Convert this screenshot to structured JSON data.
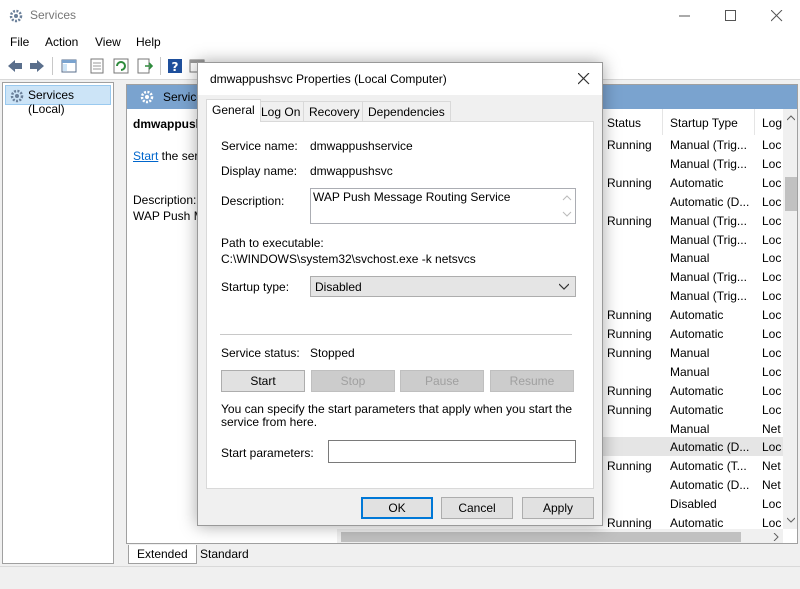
{
  "window": {
    "title": "Services",
    "menu": [
      "File",
      "Action",
      "View",
      "Help"
    ]
  },
  "tree": {
    "selected_label": "Services (Local)"
  },
  "banner": {
    "label": "Service"
  },
  "selected_service": {
    "name": "dmwappush",
    "start_link": "Start",
    "start_suffix": " the serv",
    "description_label": "Description:",
    "description_text": "WAP Push M"
  },
  "columns": {
    "status": "Status",
    "startup_type": "Startup Type",
    "log_on": "Log"
  },
  "rows": [
    {
      "status": "Running",
      "startup": "Manual (Trig...",
      "log": "Loc"
    },
    {
      "status": "",
      "startup": "Manual (Trig...",
      "log": "Loc"
    },
    {
      "status": "Running",
      "startup": "Automatic",
      "log": "Loc"
    },
    {
      "status": "",
      "startup": "Automatic (D...",
      "log": "Loc"
    },
    {
      "status": "Running",
      "startup": "Manual (Trig...",
      "log": "Loc"
    },
    {
      "status": "",
      "startup": "Manual (Trig...",
      "log": "Loc"
    },
    {
      "status": "",
      "startup": "Manual",
      "log": "Loc"
    },
    {
      "status": "",
      "startup": "Manual (Trig...",
      "log": "Loc"
    },
    {
      "status": "",
      "startup": "Manual (Trig...",
      "log": "Loc"
    },
    {
      "status": "Running",
      "startup": "Automatic",
      "log": "Loc"
    },
    {
      "status": "Running",
      "startup": "Automatic",
      "log": "Loc"
    },
    {
      "status": "Running",
      "startup": "Manual",
      "log": "Loc"
    },
    {
      "status": "",
      "startup": "Manual",
      "log": "Loc"
    },
    {
      "status": "Running",
      "startup": "Automatic",
      "log": "Loc"
    },
    {
      "status": "Running",
      "startup": "Automatic",
      "log": "Loc"
    },
    {
      "status": "",
      "startup": "Manual",
      "log": "Net"
    },
    {
      "status": "",
      "startup": "Automatic (D...",
      "log": "Loc"
    },
    {
      "status": "Running",
      "startup": "Automatic (T...",
      "log": "Net"
    },
    {
      "status": "",
      "startup": "Automatic (D...",
      "log": "Net"
    },
    {
      "status": "",
      "startup": "Disabled",
      "log": "Loc"
    },
    {
      "status": "Running",
      "startup": "Automatic",
      "log": "Loc"
    }
  ],
  "bottom_tabs": [
    "Extended",
    "Standard"
  ],
  "dialog": {
    "title": "dmwappushsvc Properties (Local Computer)",
    "tabs": [
      "General",
      "Log On",
      "Recovery",
      "Dependencies"
    ],
    "service_name_label": "Service name:",
    "service_name": "dmwappushservice",
    "display_name_label": "Display name:",
    "display_name": "dmwappushsvc",
    "description_label": "Description:",
    "description": "WAP Push Message Routing Service",
    "path_label": "Path to executable:",
    "path": "C:\\WINDOWS\\system32\\svchost.exe -k netsvcs",
    "startup_type_label": "Startup type:",
    "startup_type": "Disabled",
    "status_label": "Service status:",
    "status": "Stopped",
    "buttons": {
      "start": "Start",
      "stop": "Stop",
      "pause": "Pause",
      "resume": "Resume"
    },
    "hint": "You can specify the start parameters that apply when you start the service from here.",
    "params_label": "Start parameters:",
    "params_value": "",
    "ok": "OK",
    "cancel": "Cancel",
    "apply": "Apply"
  },
  "colors": {
    "banner": "#7aa3cf",
    "accent": "#0078d7",
    "link": "#0066cc"
  }
}
